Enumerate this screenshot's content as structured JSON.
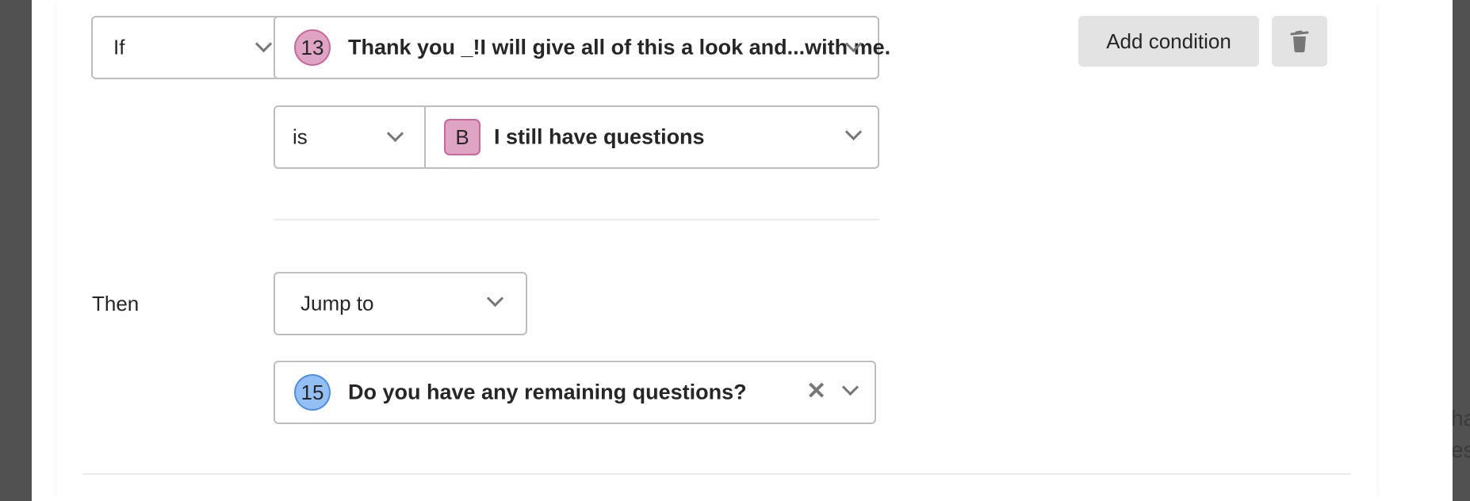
{
  "background_text": [
    "ha",
    "es"
  ],
  "rule": {
    "condition": {
      "operator_select": {
        "value": "If"
      },
      "question_select": {
        "badge": "13",
        "badge_color": "#dfa3c4",
        "badge_border": "#c9689a",
        "value": "Thank you _!I will give all of this a look and...with me."
      },
      "comparison_select": {
        "value": "is"
      },
      "answer_select": {
        "badge": "B",
        "badge_color": "#dfa3c4",
        "badge_border": "#c9689a",
        "value": "I still have questions"
      },
      "add_condition_label": "Add condition",
      "delete_icon": "trash-icon"
    },
    "action": {
      "label": "Then",
      "action_select": {
        "value": "Jump to"
      },
      "target_select": {
        "badge": "15",
        "badge_color": "#93bff5",
        "badge_border": "#4c8fe0",
        "value": "Do you have any remaining questions?",
        "clear_icon": "close-icon"
      }
    }
  }
}
